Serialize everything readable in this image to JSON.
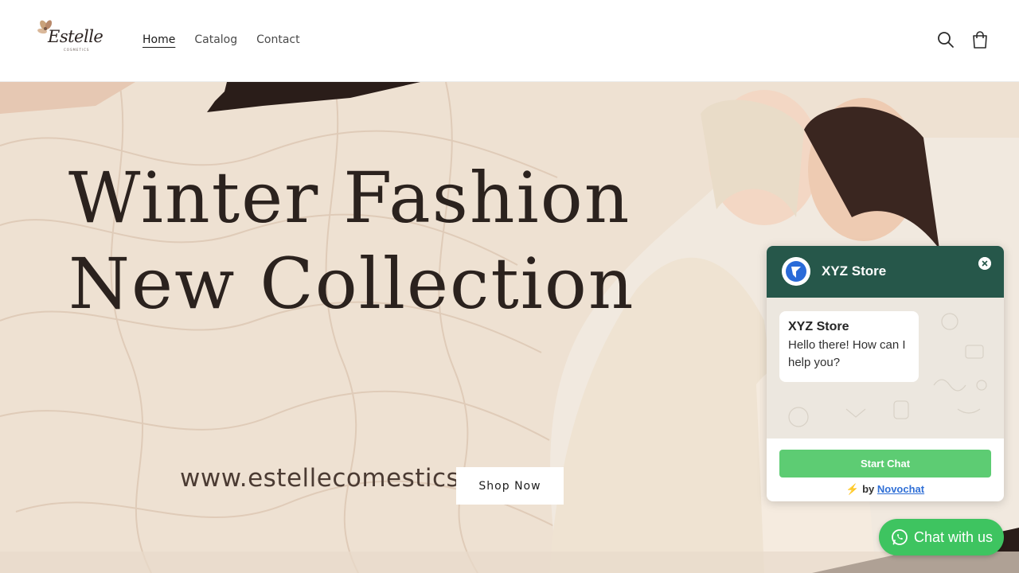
{
  "header": {
    "logo_text": "Estelle",
    "logo_sub": "COSMETICS",
    "nav": [
      {
        "label": "Home",
        "active": true
      },
      {
        "label": "Catalog",
        "active": false
      },
      {
        "label": "Contact",
        "active": false
      }
    ],
    "icons": [
      "search-icon",
      "cart-icon"
    ]
  },
  "hero": {
    "headline_line1": "Winter Fashion",
    "headline_line2": "New Collection",
    "website": "www.estellecomestics.xyz",
    "cta_label": "Shop Now",
    "colors": {
      "background": "#eee1d2",
      "text": "#2b221e",
      "accent_stroke": "#2a1d19"
    }
  },
  "chat_widget": {
    "title": "XYZ Store",
    "message_sender": "XYZ Store",
    "message_text": "Hello there! How can I help you?",
    "start_label": "Start Chat",
    "powered_prefix": "by",
    "powered_brand": "Novochat",
    "colors": {
      "header": "#26574a",
      "start_button": "#5dcc73"
    }
  },
  "fab": {
    "label": "Chat with us",
    "color": "#3ec460"
  }
}
